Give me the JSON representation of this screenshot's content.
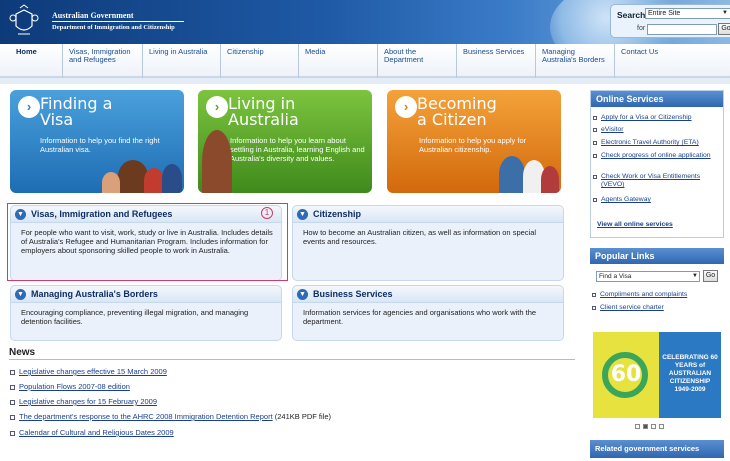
{
  "header": {
    "gov_name": "Australian Government",
    "dept_name": "Department of Immigration and Citizenship",
    "search_label": "Search",
    "search_scope": "Entire Site",
    "for_label": "for",
    "search_value": "",
    "go_label": "Go"
  },
  "nav": {
    "items": [
      {
        "label": "Home"
      },
      {
        "label": "Visas, Immigration and Refugees"
      },
      {
        "label": "Living in Australia"
      },
      {
        "label": "Citizenship"
      },
      {
        "label": "Media"
      },
      {
        "label": "About the Department"
      },
      {
        "label": "Business Services"
      },
      {
        "label": "Managing Australia's Borders"
      },
      {
        "label": "Contact Us"
      }
    ]
  },
  "features": [
    {
      "title_line1": "Finding a",
      "title_line2": "Visa",
      "desc": "Information to help you find the right Australian visa.",
      "color": "#2f86c8"
    },
    {
      "title_line1": "Living in",
      "title_line2": "Australia",
      "desc": "Information to help you learn about settling in Australia, learning English and Australia's diversity and values.",
      "color": "#5aa528"
    },
    {
      "title_line1": "Becoming",
      "title_line2": "a Citizen",
      "desc": "Information to help you apply for Australian citizenship.",
      "color": "#e47f12"
    }
  ],
  "sections": [
    {
      "title": "Visas, Immigration and Refugees",
      "desc": "For people who want to visit, work, study or live in Australia. Includes details of Australia's Refugee and Humanitarian Program. Includes information for employers about sponsoring skilled people to work in Australia."
    },
    {
      "title": "Citizenship",
      "desc": "How to become an Australian citizen, as well as information on special events and resources."
    },
    {
      "title": "Managing Australia's Borders",
      "desc": "Encouraging compliance, preventing illegal migration, and managing detention facilities."
    },
    {
      "title": "Business Services",
      "desc": "Information services for agencies and organisations who work with the department."
    }
  ],
  "highlight_marker": "1",
  "news": {
    "title": "News",
    "items": [
      {
        "text": "Legislative changes effective 15 March 2009",
        "suffix": ""
      },
      {
        "text": "Population Flows 2007-08 edition",
        "suffix": ""
      },
      {
        "text": "Legislative changes for 15 February 2009",
        "suffix": ""
      },
      {
        "text": "The department's response to the AHRC 2008 Immigration Detention Report",
        "suffix": " (241KB PDF file)"
      },
      {
        "text": "Calendar of Cultural and Religious Dates 2009",
        "suffix": ""
      }
    ]
  },
  "sidebar": {
    "online_title": "Online Services",
    "online_links": [
      "Apply for a Visa or Citizenship",
      "eVisitor",
      "Electronic Travel Authority (ETA)",
      "Check progress of online application",
      "Check Work or Visa Entitlements (VEVO)",
      "Agents Gateway"
    ],
    "view_all": "View all online services",
    "popular_title": "Popular Links",
    "visa_select": "Find a Visa",
    "go_label": "Go",
    "popular_links": [
      "Compliments and complaints",
      "Client service charter"
    ],
    "banner_ring_text": "CITIZENSHIP · CONNECTION · COMMUNITY · CELEBRATION",
    "banner_number": "60",
    "banner_text": "CELEBRATING 60 YEARS of AUSTRALIAN CITIZENSHIP 1949-2009",
    "related_title": "Related government services"
  }
}
